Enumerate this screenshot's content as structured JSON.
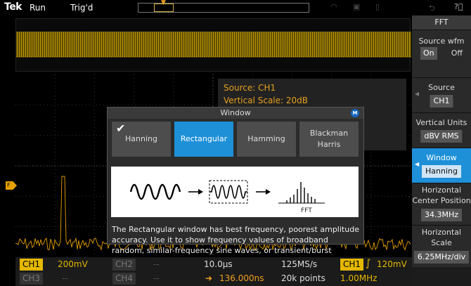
{
  "status": {
    "brand": "Tek",
    "run_state": "Run",
    "trigger_state": "Trig'd"
  },
  "fft_readout": {
    "source": "Source: CH1",
    "vertical_scale": "Vertical Scale: 20dB"
  },
  "dialog": {
    "title": "Window",
    "badge": "M",
    "options": [
      {
        "label": "Hanning",
        "selected": false,
        "checked": true
      },
      {
        "label": "Rectangular",
        "selected": true,
        "checked": false
      },
      {
        "label": "Hamming",
        "selected": false,
        "checked": false
      },
      {
        "label_line1": "Blackman",
        "label_line2": "Harris",
        "selected": false,
        "checked": false
      }
    ],
    "illustration_caption": "FFT",
    "description": "The Rectangular window has best frequency, poorest amplitude accuracy. Use it to show frequency values of broadband random, similar-frequency sine waves, or transient/burst signals."
  },
  "bottom_bar": {
    "ch1_label": "CH1",
    "ch1_scale": "200mV",
    "ch2_label": "CH2",
    "ch2_value": "--",
    "ch3_label": "CH3",
    "ch3_value": "--",
    "ch4_label": "CH4",
    "ch4_value": "--",
    "timebase": "10.0µs",
    "sample_rate": "125MS/s",
    "trigger_source": "CH1",
    "trigger_level": "120mV",
    "trigger_position": "136.000ns",
    "record_length": "20k points",
    "frequency": "1.00MHz"
  },
  "side_menu": {
    "title": "FFT",
    "source_wfm_label": "Source wfm",
    "source_wfm_on": "On",
    "source_wfm_off": "Off",
    "source_label": "Source",
    "source_value": "CH1",
    "vertical_units_label": "Vertical Units",
    "vertical_units_value": "dBV RMS",
    "window_label": "Window",
    "window_value": "Hanning",
    "hcenter_label_line1": "Horizontal",
    "hcenter_label_line2": "Center Position",
    "hcenter_value": "34.3MHz",
    "hscale_label_line1": "Horizontal",
    "hscale_label_line2": "Scale",
    "hscale_value": "6.25MHz/div"
  },
  "colors": {
    "ch1_yellow": "#e5b800",
    "selection_blue": "#1e90d8",
    "fft_orange": "#e5a020"
  },
  "icons": [
    "checkmark-icon",
    "help-icon",
    "back-arrow-icon",
    "usb-icon",
    "lock-icon",
    "wifi-icon",
    "trigger-edge-icon",
    "trigger-position-arrow-icon",
    "channel-ground-marker-icon",
    "menu-left-arrow-icon"
  ]
}
